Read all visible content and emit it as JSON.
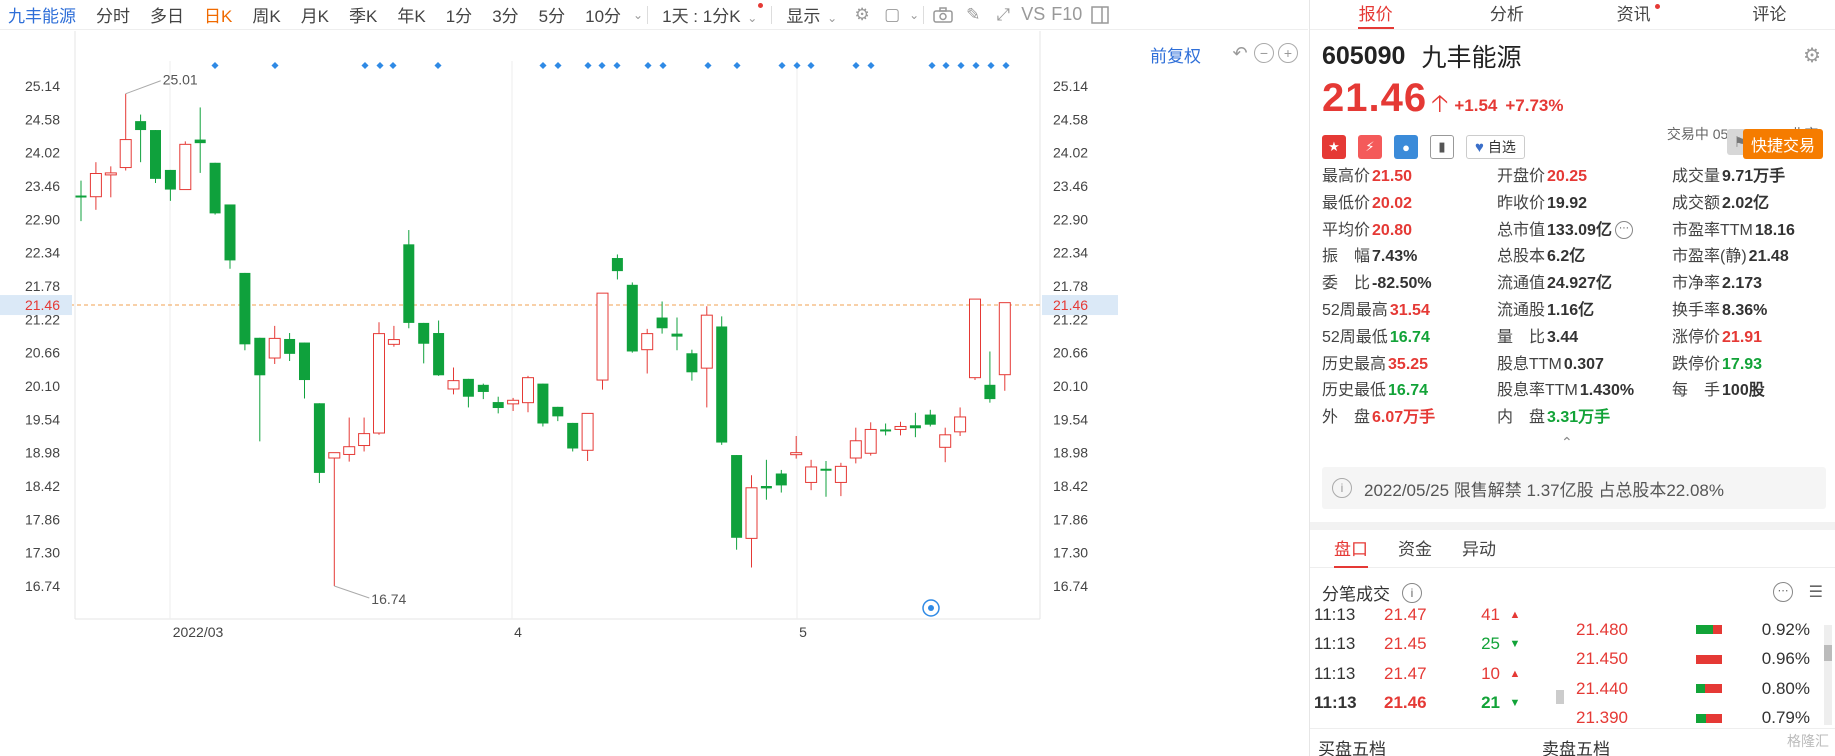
{
  "toolbar": {
    "stock_name": "九丰能源",
    "periods": [
      "分时",
      "多日",
      "日K",
      "周K",
      "月K",
      "季K",
      "年K",
      "1分",
      "3分",
      "5分",
      "10分"
    ],
    "active_period": "日K",
    "range_select": "1天 : 1分K",
    "display_label": "显示",
    "vs_label": "VS",
    "f10_label": "F10"
  },
  "chart": {
    "restore_label": "前复权",
    "current_price_label": "21.46",
    "high_label": "25.01",
    "low_label": "16.74",
    "colors": {
      "up": "#e53935",
      "down": "#0fa13c",
      "marker": "#2f8ae5",
      "price_line": "#f0a050"
    }
  },
  "chart_data": {
    "type": "candlestick",
    "y_ticks": [
      "25.14",
      "24.58",
      "24.02",
      "23.46",
      "22.90",
      "22.34",
      "21.78",
      "21.22",
      "20.66",
      "20.10",
      "19.54",
      "18.98",
      "18.42",
      "17.86",
      "17.30",
      "16.74"
    ],
    "x_labels": [
      "2022/03",
      "4",
      "5"
    ],
    "ylim": [
      16.5,
      25.4
    ],
    "current_price": 21.46,
    "max_label": 25.01,
    "min_label": 16.74,
    "candles": [
      [
        23.3,
        23.28,
        23.55,
        22.87
      ],
      [
        23.28,
        23.67,
        23.86,
        23.06
      ],
      [
        23.67,
        23.68,
        23.79,
        23.27
      ],
      [
        23.77,
        24.24,
        25.01,
        23.72
      ],
      [
        24.55,
        24.4,
        24.66,
        23.86
      ],
      [
        24.4,
        23.58,
        24.4,
        23.51
      ],
      [
        23.73,
        23.4,
        23.73,
        23.21
      ],
      [
        23.4,
        24.16,
        24.21,
        23.4
      ],
      [
        24.24,
        24.18,
        24.78,
        23.68
      ],
      [
        23.85,
        23.0,
        23.85,
        22.98
      ],
      [
        23.15,
        22.21,
        23.15,
        22.07
      ],
      [
        22.0,
        20.8,
        22.0,
        20.7
      ],
      [
        20.91,
        20.28,
        20.91,
        19.17
      ],
      [
        20.57,
        20.9,
        21.11,
        20.47
      ],
      [
        20.89,
        20.64,
        20.99,
        20.52
      ],
      [
        20.83,
        20.2,
        20.83,
        19.89
      ],
      [
        19.81,
        18.64,
        19.81,
        18.47
      ],
      [
        18.89,
        18.98,
        18.98,
        16.74
      ],
      [
        18.95,
        19.08,
        19.57,
        18.83
      ],
      [
        19.1,
        19.3,
        19.57,
        19.0
      ],
      [
        19.31,
        20.98,
        21.17,
        19.28
      ],
      [
        20.8,
        20.88,
        21.11,
        20.76
      ],
      [
        22.48,
        21.16,
        22.72,
        21.07
      ],
      [
        21.16,
        20.81,
        21.16,
        20.48
      ],
      [
        20.99,
        20.28,
        21.2,
        20.27
      ],
      [
        20.05,
        20.19,
        20.41,
        19.96
      ],
      [
        20.22,
        19.92,
        20.22,
        19.74
      ],
      [
        20.12,
        20.0,
        20.14,
        19.88
      ],
      [
        19.83,
        19.73,
        19.92,
        19.64
      ],
      [
        19.8,
        19.86,
        19.9,
        19.68
      ],
      [
        19.82,
        20.24,
        20.27,
        19.66
      ],
      [
        20.14,
        19.47,
        20.14,
        19.42
      ],
      [
        19.75,
        19.59,
        19.75,
        19.51
      ],
      [
        19.48,
        19.05,
        19.48,
        19.0
      ],
      [
        19.02,
        19.64,
        19.64,
        18.84
      ],
      [
        20.2,
        21.66,
        21.66,
        20.04
      ],
      [
        22.25,
        22.03,
        22.31,
        21.89
      ],
      [
        21.8,
        20.68,
        21.84,
        20.66
      ],
      [
        20.71,
        20.98,
        21.06,
        20.31
      ],
      [
        21.25,
        21.07,
        21.52,
        20.98
      ],
      [
        20.98,
        20.93,
        21.25,
        20.7
      ],
      [
        20.65,
        20.33,
        20.71,
        20.19
      ],
      [
        20.4,
        21.29,
        21.44,
        19.74
      ],
      [
        21.1,
        19.15,
        21.27,
        19.11
      ],
      [
        18.94,
        17.55,
        18.94,
        17.35
      ],
      [
        17.54,
        18.39,
        18.6,
        17.05
      ],
      [
        18.42,
        18.38,
        18.86,
        18.19
      ],
      [
        18.63,
        18.43,
        18.69,
        18.31
      ],
      [
        18.96,
        18.98,
        19.26,
        18.88
      ],
      [
        18.48,
        18.74,
        18.86,
        18.35
      ],
      [
        18.71,
        18.7,
        18.84,
        18.24
      ],
      [
        18.48,
        18.75,
        18.81,
        18.25
      ],
      [
        18.89,
        19.18,
        19.4,
        18.8
      ],
      [
        18.97,
        19.37,
        19.49,
        18.93
      ],
      [
        19.37,
        19.34,
        19.47,
        19.27
      ],
      [
        19.37,
        19.42,
        19.5,
        19.27
      ],
      [
        19.44,
        19.39,
        19.65,
        19.24
      ],
      [
        19.62,
        19.45,
        19.7,
        19.42
      ],
      [
        19.07,
        19.28,
        19.4,
        18.82
      ],
      [
        19.33,
        19.58,
        19.74,
        19.26
      ],
      [
        20.24,
        21.56,
        21.56,
        20.2
      ],
      [
        20.12,
        19.88,
        20.68,
        19.82
      ],
      [
        20.29,
        21.5,
        21.5,
        20.02
      ]
    ],
    "markers": [
      215,
      275,
      365,
      380,
      393,
      438,
      543,
      558,
      588,
      602,
      617,
      648,
      663,
      708,
      737,
      782,
      797,
      811,
      856,
      871,
      932,
      946,
      961,
      976,
      991,
      1006
    ]
  },
  "quote": {
    "tabs": [
      "报价",
      "分析",
      "资讯",
      "评论"
    ],
    "active_tab": "报价",
    "code": "605090",
    "name": "九丰能源",
    "price": "21.46",
    "change": "+1.54",
    "change_pct": "+7.73%",
    "status": "交易中 05/25 11:13(北京)",
    "watch_label": "自选",
    "trade_label": "快捷交易",
    "fields": [
      {
        "label": "最高价",
        "value": "21.50",
        "cls": "red"
      },
      {
        "label": "开盘价",
        "value": "20.25",
        "cls": "red"
      },
      {
        "label": "成交量",
        "value": "9.71万手",
        "cls": "dark"
      },
      {
        "label": "最低价",
        "value": "20.02",
        "cls": "red"
      },
      {
        "label": "昨收价",
        "value": "19.92",
        "cls": "dark"
      },
      {
        "label": "成交额",
        "value": "2.02亿",
        "cls": "dark"
      },
      {
        "label": "平均价",
        "value": "20.80",
        "cls": "red"
      },
      {
        "label": "总市值",
        "value": "133.09亿",
        "cls": "dark"
      },
      {
        "label": "市盈率TTM",
        "value": "18.16",
        "cls": "dark"
      },
      {
        "label": "振　幅",
        "value": "7.43%",
        "cls": "dark"
      },
      {
        "label": "总股本",
        "value": "6.2亿",
        "cls": "dark"
      },
      {
        "label": "市盈率(静)",
        "value": "21.48",
        "cls": "dark"
      },
      {
        "label": "委　比",
        "value": "-82.50%",
        "cls": "dark"
      },
      {
        "label": "流通值",
        "value": "24.927亿",
        "cls": "dark"
      },
      {
        "label": "市净率",
        "value": "2.173",
        "cls": "dark"
      },
      {
        "label": "52周最高",
        "value": "31.54",
        "cls": "red"
      },
      {
        "label": "流通股",
        "value": "1.16亿",
        "cls": "dark"
      },
      {
        "label": "换手率",
        "value": "8.36%",
        "cls": "dark"
      },
      {
        "label": "52周最低",
        "value": "16.74",
        "cls": "green"
      },
      {
        "label": "量　比",
        "value": "3.44",
        "cls": "dark"
      },
      {
        "label": "涨停价",
        "value": "21.91",
        "cls": "red"
      },
      {
        "label": "历史最高",
        "value": "35.25",
        "cls": "red"
      },
      {
        "label": "股息TTM",
        "value": "0.307",
        "cls": "dark"
      },
      {
        "label": "跌停价",
        "value": "17.93",
        "cls": "green"
      },
      {
        "label": "历史最低",
        "value": "16.74",
        "cls": "green"
      },
      {
        "label": "股息率TTM",
        "value": "1.430%",
        "cls": "dark"
      },
      {
        "label": "每　手",
        "value": "100股",
        "cls": "dark"
      },
      {
        "label": "外　盘",
        "value": "6.07万手",
        "cls": "red"
      },
      {
        "label": "内　盘",
        "value": "3.31万手",
        "cls": "green"
      }
    ],
    "notice": "2022/05/25  限售解禁 1.37亿股 占总股本22.08%"
  },
  "orderbook": {
    "subtabs": [
      "盘口",
      "资金",
      "异动"
    ],
    "active_subtab": "盘口",
    "trades_title": "分笔成交",
    "trades": [
      {
        "time": "11:13",
        "price": "21.47",
        "vol": "41",
        "dir": "up"
      },
      {
        "time": "11:13",
        "price": "21.45",
        "vol": "25",
        "dir": "down"
      },
      {
        "time": "11:13",
        "price": "21.47",
        "vol": "10",
        "dir": "up"
      },
      {
        "time": "11:13",
        "price": "21.46",
        "vol": "21",
        "dir": "down"
      }
    ],
    "distribution": [
      {
        "price": "21.480",
        "pct": "0.92%",
        "green": 0.65
      },
      {
        "price": "21.450",
        "pct": "0.96%",
        "green": 0.0
      },
      {
        "price": "21.440",
        "pct": "0.80%",
        "green": 0.35
      },
      {
        "price": "21.390",
        "pct": "0.79%",
        "green": 0.4
      }
    ],
    "buy_label": "买盘五档",
    "sell_label": "卖盘五档",
    "watermark": "格隆汇"
  }
}
